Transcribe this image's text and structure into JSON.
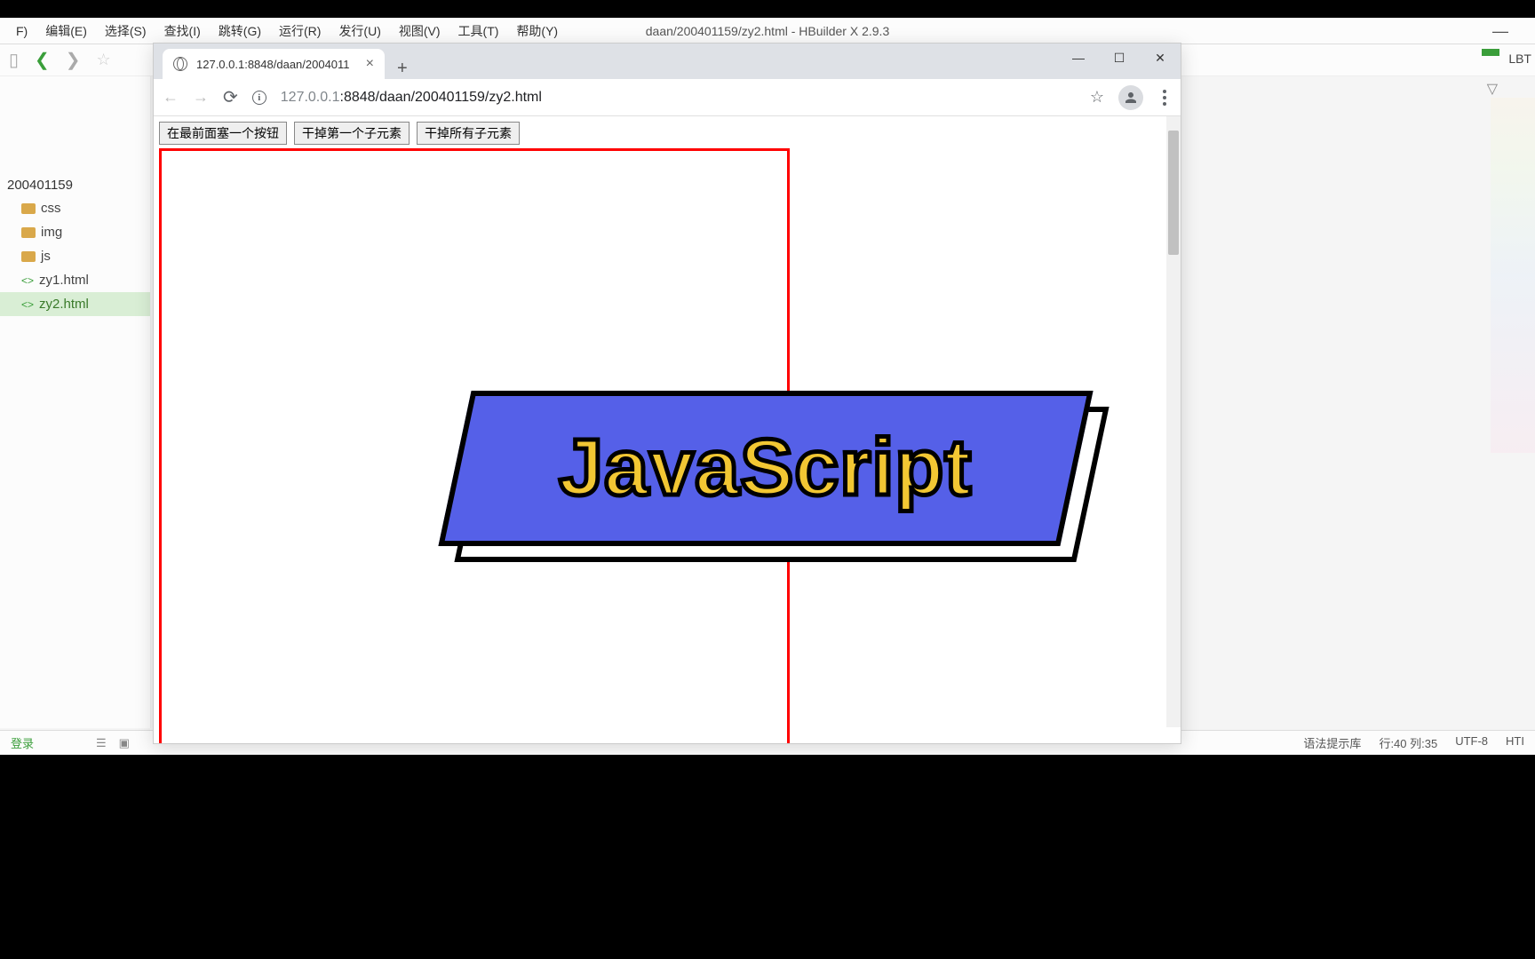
{
  "hbuilder": {
    "title": "daan/200401159/zy2.html - HBuilder X 2.9.3",
    "menus": [
      "F)",
      "编辑(E)",
      "选择(S)",
      "查找(I)",
      "跳转(G)",
      "运行(R)",
      "发行(U)",
      "视图(V)",
      "工具(T)",
      "帮助(Y)"
    ],
    "right_label": "LBT",
    "project": "200401159",
    "tree": [
      {
        "icon": "folder",
        "label": "css"
      },
      {
        "icon": "folder",
        "label": "img"
      },
      {
        "icon": "folder",
        "label": "js"
      },
      {
        "icon": "html",
        "label": "zy1.html"
      },
      {
        "icon": "html",
        "label": "zy2.html",
        "selected": true
      }
    ],
    "status": {
      "left": "登录",
      "syntax": "语法提示库",
      "cursor": "行:40 列:35",
      "encoding": "UTF-8",
      "lang": "HTI"
    }
  },
  "browser": {
    "tab_title": "127.0.0.1:8848/daan/2004011",
    "url_gray": "127.0.0.1",
    "url_rest": ":8848/daan/200401159/zy2.html",
    "buttons": [
      "在最前面塞一个按钮",
      "干掉第一个子元素",
      "干掉所有子元素"
    ]
  },
  "banner": {
    "text": "JavaScript"
  }
}
